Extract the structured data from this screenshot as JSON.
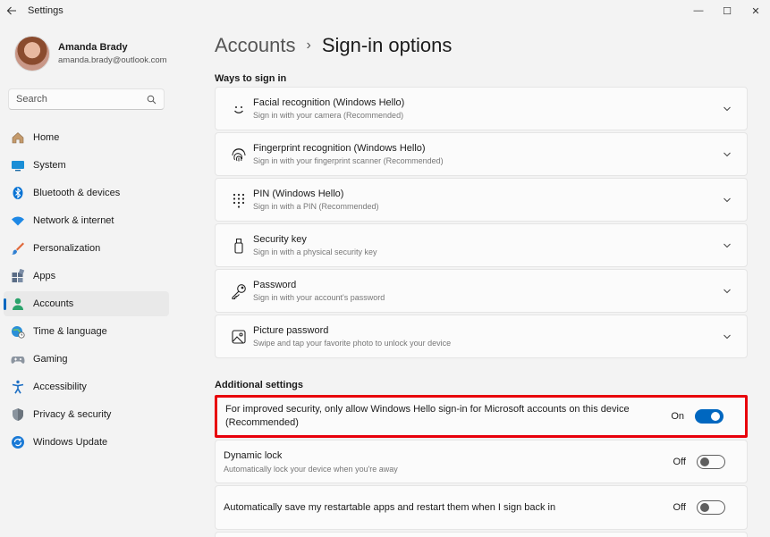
{
  "window": {
    "title": "Settings",
    "back_icon": "back-arrow-icon",
    "minimize_glyph": "—",
    "maximize_glyph": "☐",
    "close_glyph": "✕"
  },
  "profile": {
    "name": "Amanda Brady",
    "email": "amanda.brady@outlook.com"
  },
  "search": {
    "placeholder": "Search"
  },
  "sidebar": {
    "items": [
      {
        "label": "Home",
        "icon": "home-icon"
      },
      {
        "label": "System",
        "icon": "monitor-icon"
      },
      {
        "label": "Bluetooth & devices",
        "icon": "bluetooth-icon"
      },
      {
        "label": "Network & internet",
        "icon": "wifi-icon"
      },
      {
        "label": "Personalization",
        "icon": "paintbrush-icon"
      },
      {
        "label": "Apps",
        "icon": "apps-icon"
      },
      {
        "label": "Accounts",
        "icon": "person-icon",
        "active": true
      },
      {
        "label": "Time & language",
        "icon": "globe-clock-icon"
      },
      {
        "label": "Gaming",
        "icon": "gamepad-icon"
      },
      {
        "label": "Accessibility",
        "icon": "accessibility-icon"
      },
      {
        "label": "Privacy & security",
        "icon": "shield-icon"
      },
      {
        "label": "Windows Update",
        "icon": "update-icon"
      }
    ]
  },
  "breadcrumb": {
    "parent": "Accounts",
    "separator": "›",
    "current": "Sign-in options"
  },
  "ways_to_sign_in": {
    "title": "Ways to sign in",
    "items": [
      {
        "title": "Facial recognition (Windows Hello)",
        "subtitle": "Sign in with your camera (Recommended)",
        "icon": "face-icon"
      },
      {
        "title": "Fingerprint recognition (Windows Hello)",
        "subtitle": "Sign in with your fingerprint scanner (Recommended)",
        "icon": "fingerprint-icon"
      },
      {
        "title": "PIN (Windows Hello)",
        "subtitle": "Sign in with a PIN (Recommended)",
        "icon": "pin-keypad-icon"
      },
      {
        "title": "Security key",
        "subtitle": "Sign in with a physical security key",
        "icon": "usb-key-icon"
      },
      {
        "title": "Password",
        "subtitle": "Sign in with your account's password",
        "icon": "key-icon"
      },
      {
        "title": "Picture password",
        "subtitle": "Swipe and tap your favorite photo to unlock your device",
        "icon": "picture-icon"
      }
    ]
  },
  "additional_settings": {
    "title": "Additional settings",
    "items": [
      {
        "title": "For improved security, only allow Windows Hello sign-in for Microsoft accounts on this device (Recommended)",
        "subtitle": "",
        "state": "On"
      },
      {
        "title": "Dynamic lock",
        "subtitle": "Automatically lock your device when you're away",
        "state": "Off"
      },
      {
        "title": "Automatically save my restartable apps and restart them when I sign back in",
        "subtitle": "",
        "state": "Off"
      }
    ]
  },
  "colors": {
    "accent": "#0067c0",
    "highlight": "#e8000b"
  }
}
